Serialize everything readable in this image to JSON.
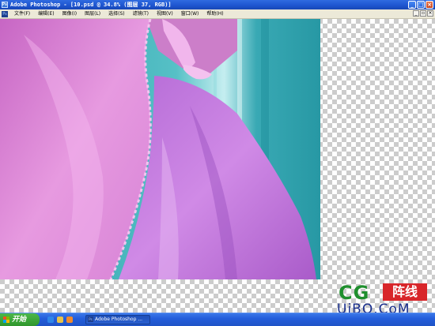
{
  "window": {
    "title": "Adobe Photoshop - [10.psd @ 34.8% (图层 37, RGB)]",
    "minimize": "_",
    "maximize": "□",
    "close": "×"
  },
  "menu": {
    "items": [
      {
        "label": "文件(F)"
      },
      {
        "label": "编辑(E)"
      },
      {
        "label": "图像(I)"
      },
      {
        "label": "图层(L)"
      },
      {
        "label": "选择(S)"
      },
      {
        "label": "滤镜(T)"
      },
      {
        "label": "视图(V)"
      },
      {
        "label": "窗口(W)"
      },
      {
        "label": "帮助(H)"
      }
    ]
  },
  "canvas": {
    "document": "10.psd",
    "zoom": "34.8%",
    "layer": "图层 37",
    "mode": "RGB"
  },
  "watermark": {
    "brand": "CG",
    "box": "阵线",
    "url": "UiBQ.CoM"
  },
  "taskbar": {
    "start_label": "开始",
    "task_label": "Adobe Photoshop ...",
    "quick_launch": [
      "ie-icon",
      "desktop-icon",
      "media-icon"
    ]
  },
  "colors": {
    "background_teal": "#2ba3ae",
    "dress_pink": "#d77ad6",
    "dress_purple": "#b56bd6"
  }
}
